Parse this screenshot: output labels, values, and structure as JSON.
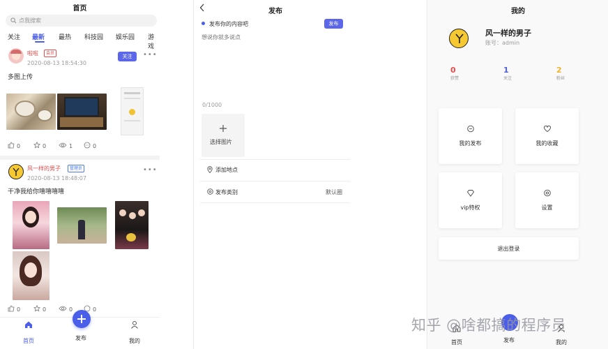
{
  "feed": {
    "title": "首页",
    "search_placeholder": "点我搜索",
    "tabs": [
      "关注",
      "最新",
      "最热",
      "科技园",
      "娱乐园",
      "游戏"
    ],
    "active_tab": "最新",
    "posts": [
      {
        "author": "啦啦",
        "role": "会员",
        "time": "2020-08-13 18:54:30",
        "text": "多图上传",
        "follow": "关注",
        "likes": "0",
        "stars": "0",
        "views": "1",
        "comments": "0"
      },
      {
        "author": "风一样的男子",
        "role": "管理员",
        "time": "2020-08-13 18:48:07",
        "text": "干净我给你嘻嘻嘻嘻",
        "likes": "0",
        "stars": "0",
        "views": "0",
        "comments": "0"
      }
    ],
    "nav": {
      "home": "首页",
      "publish": "发布",
      "mine": "我的"
    }
  },
  "publish": {
    "title": "发布",
    "content_label": "发布你的内容吧",
    "submit": "发布",
    "placeholder": "想说你就多说点",
    "counter": "0/1000",
    "add_image": "选择图片",
    "location": "添加地点",
    "category": "发布类别",
    "category_value": "默认圈"
  },
  "profile": {
    "title": "我的",
    "name": "风一样的男子",
    "account": "账号：admin",
    "stats": [
      {
        "value": "0",
        "label": "获赞",
        "color": "#e94b4b"
      },
      {
        "value": "1",
        "label": "关注",
        "color": "#4b5ee9"
      },
      {
        "value": "2",
        "label": "粉丝",
        "color": "#f0b429"
      }
    ],
    "menu": [
      "我的发布",
      "我的收藏",
      "vip特权",
      "设置"
    ],
    "logout": "退出登录",
    "nav": {
      "home": "首页",
      "publish": "发布",
      "mine": "我的"
    }
  },
  "watermark": "知乎 @啥都搞的程序员"
}
